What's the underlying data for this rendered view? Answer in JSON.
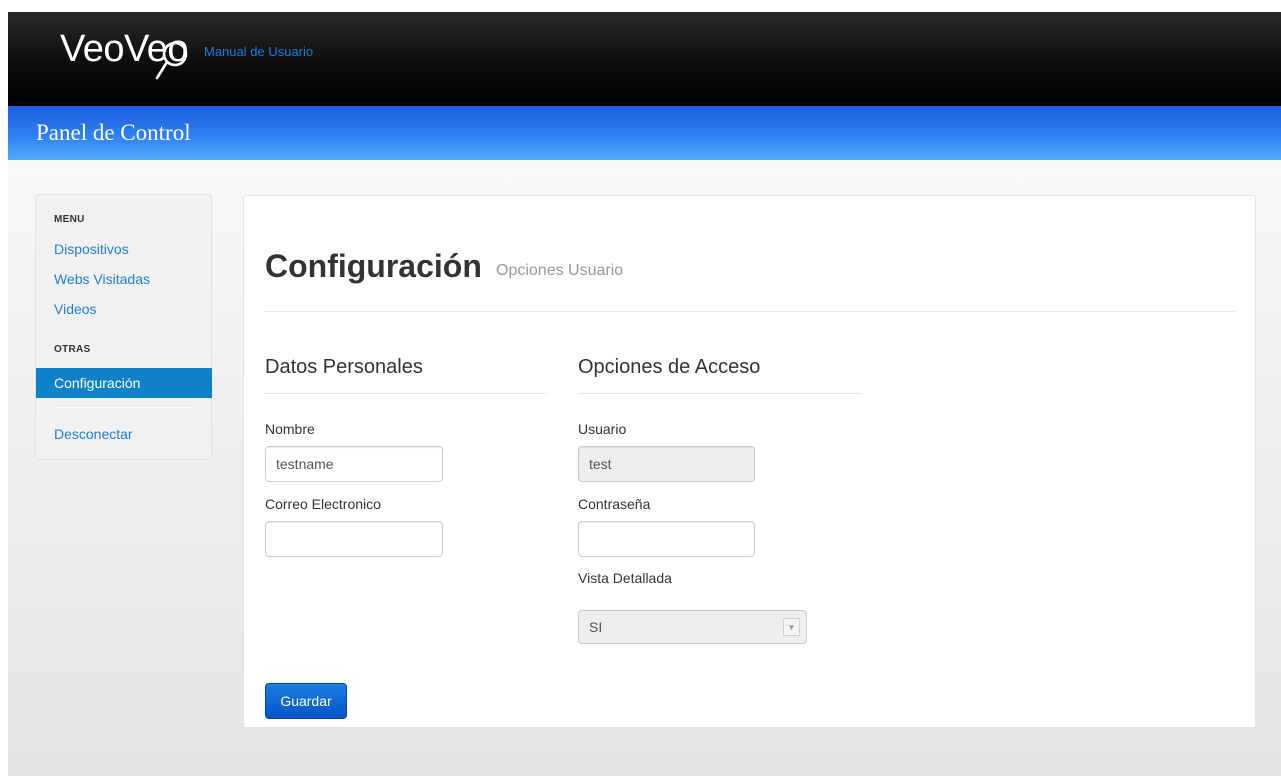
{
  "header": {
    "brand": "VeoVeo",
    "brand_subtitle": "Manual de Usuario",
    "panel_title": "Panel de Control"
  },
  "sidebar": {
    "menu_header": "MENU",
    "items": [
      {
        "label": "Dispositivos"
      },
      {
        "label": "Webs Visitadas"
      },
      {
        "label": "Videos"
      }
    ],
    "other_header": "OTRAS",
    "active_item": "Configuración",
    "logout": "Desconectar"
  },
  "main": {
    "title": "Configuración",
    "subtitle": "Opciones Usuario",
    "personal": {
      "title": "Datos Personales",
      "name_label": "Nombre",
      "name_value": "testname",
      "email_label": "Correo Electronico",
      "email_value": ""
    },
    "access": {
      "title": "Opciones de Acceso",
      "user_label": "Usuario",
      "user_value": "test",
      "password_label": "Contraseña",
      "password_value": "",
      "view_label": "Vista Detallada",
      "view_value": "SI"
    },
    "save_label": "Guardar"
  },
  "colors": {
    "topbar": "#000000",
    "bluebar": "#2e80f0",
    "link": "#1e7fd2",
    "active_nav": "#0f81c9",
    "primary_button": "#0755c8"
  }
}
